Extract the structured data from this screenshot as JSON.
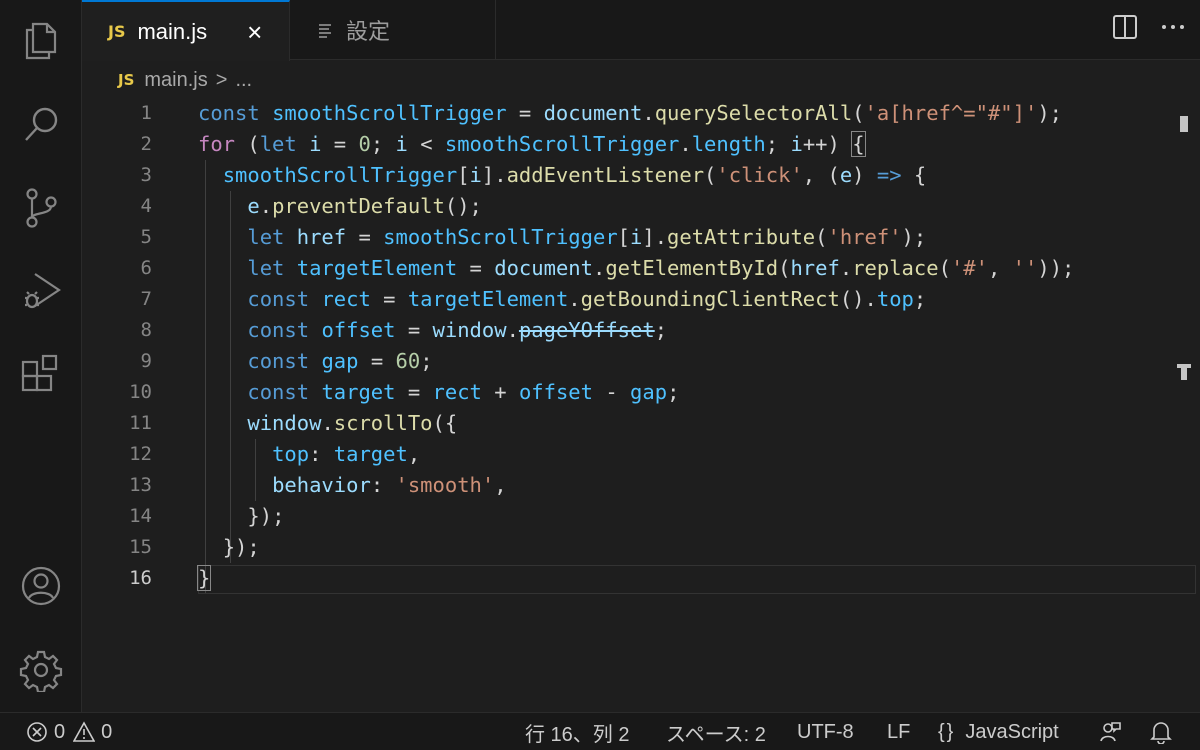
{
  "tabs": [
    {
      "badge": "JS",
      "label": "main.js",
      "close": "×",
      "active": true
    },
    {
      "label": "設定",
      "active": false
    }
  ],
  "breadcrumb": {
    "badge": "JS",
    "file": "main.js",
    "separator": ">",
    "more": "..."
  },
  "editor": {
    "current_line": 16,
    "line_numbers": [
      "1",
      "2",
      "3",
      "4",
      "5",
      "6",
      "7",
      "8",
      "9",
      "10",
      "11",
      "12",
      "13",
      "14",
      "15",
      "16"
    ],
    "lines": [
      "const smoothScrollTrigger = document.querySelectorAll('a[href^=\"#\"]');",
      "for (let i = 0; i < smoothScrollTrigger.length; i++) {",
      "  smoothScrollTrigger[i].addEventListener('click', (e) => {",
      "    e.preventDefault();",
      "    let href = smoothScrollTrigger[i].getAttribute('href');",
      "    let targetElement = document.getElementById(href.replace('#', ''));",
      "    const rect = targetElement.getBoundingClientRect().top;",
      "    const offset = window.pageYOffset;",
      "    const gap = 60;",
      "    const target = rect + offset - gap;",
      "    window.scrollTo({",
      "      top: target,",
      "      behavior: 'smooth',",
      "    });",
      "  });",
      "}"
    ]
  },
  "status": {
    "errors": "0",
    "warnings": "0",
    "position": "行 16、列 2",
    "spaces": "スペース: 2",
    "encoding": "UTF-8",
    "eol": "LF",
    "language_braces": "{}",
    "language": "JavaScript"
  },
  "colors": {
    "accent": "#0078d4",
    "js_badge": "#e8c94a",
    "keyword": "#569cd6",
    "control_keyword": "#c586c0",
    "variable": "#9cdcfe",
    "constant": "#4fc1ff",
    "function": "#dcdcaa",
    "string": "#ce9178",
    "number": "#b5cea8"
  },
  "icons": {
    "activity": [
      "files-icon",
      "search-icon",
      "source-control-icon",
      "run-debug-icon",
      "extensions-icon",
      "account-icon",
      "settings-gear-icon"
    ],
    "tab_actions": [
      "split-editor-icon",
      "more-actions-icon"
    ],
    "status": [
      "error-icon",
      "warning-icon",
      "feedback-icon",
      "bell-icon"
    ]
  }
}
